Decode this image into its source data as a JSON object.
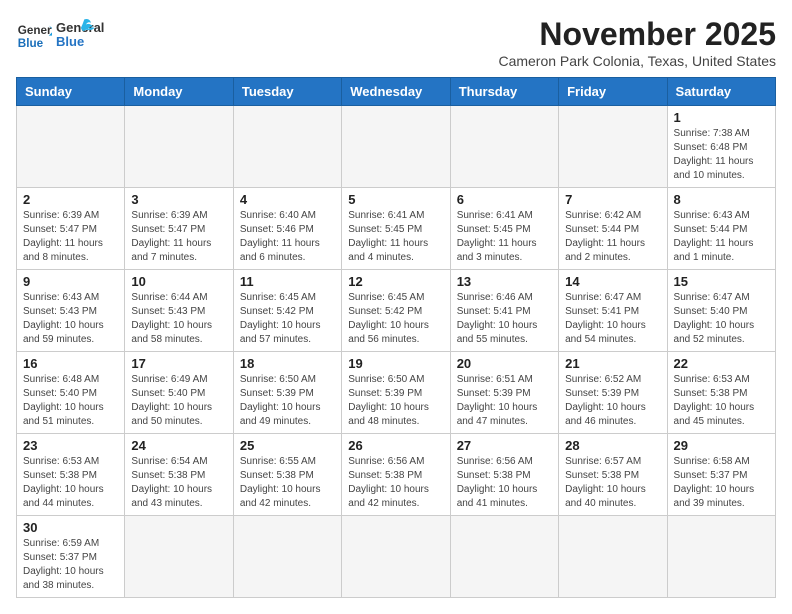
{
  "header": {
    "logo_line1": "General",
    "logo_line2": "Blue",
    "title": "November 2025",
    "subtitle": "Cameron Park Colonia, Texas, United States"
  },
  "days_of_week": [
    "Sunday",
    "Monday",
    "Tuesday",
    "Wednesday",
    "Thursday",
    "Friday",
    "Saturday"
  ],
  "weeks": [
    [
      {
        "day": "",
        "empty": true
      },
      {
        "day": "",
        "empty": true
      },
      {
        "day": "",
        "empty": true
      },
      {
        "day": "",
        "empty": true
      },
      {
        "day": "",
        "empty": true
      },
      {
        "day": "",
        "empty": true
      },
      {
        "day": "1",
        "sunrise": "7:38 AM",
        "sunset": "6:48 PM",
        "daylight": "11 hours and 10 minutes."
      }
    ],
    [
      {
        "day": "2",
        "sunrise": "6:39 AM",
        "sunset": "5:47 PM",
        "daylight": "11 hours and 8 minutes."
      },
      {
        "day": "3",
        "sunrise": "6:39 AM",
        "sunset": "5:47 PM",
        "daylight": "11 hours and 7 minutes."
      },
      {
        "day": "4",
        "sunrise": "6:40 AM",
        "sunset": "5:46 PM",
        "daylight": "11 hours and 6 minutes."
      },
      {
        "day": "5",
        "sunrise": "6:41 AM",
        "sunset": "5:45 PM",
        "daylight": "11 hours and 4 minutes."
      },
      {
        "day": "6",
        "sunrise": "6:41 AM",
        "sunset": "5:45 PM",
        "daylight": "11 hours and 3 minutes."
      },
      {
        "day": "7",
        "sunrise": "6:42 AM",
        "sunset": "5:44 PM",
        "daylight": "11 hours and 2 minutes."
      },
      {
        "day": "8",
        "sunrise": "6:43 AM",
        "sunset": "5:44 PM",
        "daylight": "11 hours and 1 minute."
      }
    ],
    [
      {
        "day": "9",
        "sunrise": "6:43 AM",
        "sunset": "5:43 PM",
        "daylight": "10 hours and 59 minutes."
      },
      {
        "day": "10",
        "sunrise": "6:44 AM",
        "sunset": "5:43 PM",
        "daylight": "10 hours and 58 minutes."
      },
      {
        "day": "11",
        "sunrise": "6:45 AM",
        "sunset": "5:42 PM",
        "daylight": "10 hours and 57 minutes."
      },
      {
        "day": "12",
        "sunrise": "6:45 AM",
        "sunset": "5:42 PM",
        "daylight": "10 hours and 56 minutes."
      },
      {
        "day": "13",
        "sunrise": "6:46 AM",
        "sunset": "5:41 PM",
        "daylight": "10 hours and 55 minutes."
      },
      {
        "day": "14",
        "sunrise": "6:47 AM",
        "sunset": "5:41 PM",
        "daylight": "10 hours and 54 minutes."
      },
      {
        "day": "15",
        "sunrise": "6:47 AM",
        "sunset": "5:40 PM",
        "daylight": "10 hours and 52 minutes."
      }
    ],
    [
      {
        "day": "16",
        "sunrise": "6:48 AM",
        "sunset": "5:40 PM",
        "daylight": "10 hours and 51 minutes."
      },
      {
        "day": "17",
        "sunrise": "6:49 AM",
        "sunset": "5:40 PM",
        "daylight": "10 hours and 50 minutes."
      },
      {
        "day": "18",
        "sunrise": "6:50 AM",
        "sunset": "5:39 PM",
        "daylight": "10 hours and 49 minutes."
      },
      {
        "day": "19",
        "sunrise": "6:50 AM",
        "sunset": "5:39 PM",
        "daylight": "10 hours and 48 minutes."
      },
      {
        "day": "20",
        "sunrise": "6:51 AM",
        "sunset": "5:39 PM",
        "daylight": "10 hours and 47 minutes."
      },
      {
        "day": "21",
        "sunrise": "6:52 AM",
        "sunset": "5:39 PM",
        "daylight": "10 hours and 46 minutes."
      },
      {
        "day": "22",
        "sunrise": "6:53 AM",
        "sunset": "5:38 PM",
        "daylight": "10 hours and 45 minutes."
      }
    ],
    [
      {
        "day": "23",
        "sunrise": "6:53 AM",
        "sunset": "5:38 PM",
        "daylight": "10 hours and 44 minutes."
      },
      {
        "day": "24",
        "sunrise": "6:54 AM",
        "sunset": "5:38 PM",
        "daylight": "10 hours and 43 minutes."
      },
      {
        "day": "25",
        "sunrise": "6:55 AM",
        "sunset": "5:38 PM",
        "daylight": "10 hours and 42 minutes."
      },
      {
        "day": "26",
        "sunrise": "6:56 AM",
        "sunset": "5:38 PM",
        "daylight": "10 hours and 42 minutes."
      },
      {
        "day": "27",
        "sunrise": "6:56 AM",
        "sunset": "5:38 PM",
        "daylight": "10 hours and 41 minutes."
      },
      {
        "day": "28",
        "sunrise": "6:57 AM",
        "sunset": "5:38 PM",
        "daylight": "10 hours and 40 minutes."
      },
      {
        "day": "29",
        "sunrise": "6:58 AM",
        "sunset": "5:37 PM",
        "daylight": "10 hours and 39 minutes."
      }
    ],
    [
      {
        "day": "30",
        "sunrise": "6:59 AM",
        "sunset": "5:37 PM",
        "daylight": "10 hours and 38 minutes."
      },
      {
        "day": "",
        "empty": true
      },
      {
        "day": "",
        "empty": true
      },
      {
        "day": "",
        "empty": true
      },
      {
        "day": "",
        "empty": true
      },
      {
        "day": "",
        "empty": true
      },
      {
        "day": "",
        "empty": true
      }
    ]
  ],
  "labels": {
    "sunrise_prefix": "Sunrise: ",
    "sunset_prefix": "Sunset: ",
    "daylight_prefix": "Daylight: "
  }
}
